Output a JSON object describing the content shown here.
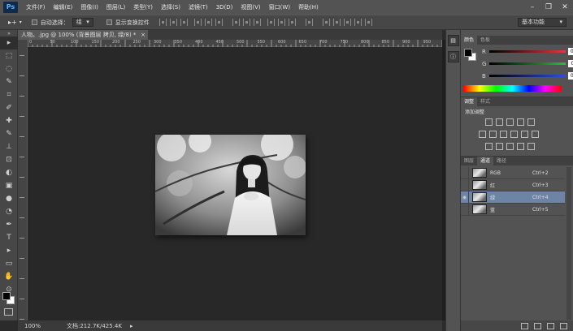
{
  "app": {
    "logo": "Ps"
  },
  "menu": [
    "文件(F)",
    "编辑(E)",
    "图像(I)",
    "图层(L)",
    "类型(Y)",
    "选择(S)",
    "滤镜(T)",
    "3D(D)",
    "视图(V)",
    "窗口(W)",
    "帮助(H)"
  ],
  "window_controls": {
    "minimize": "–",
    "restore": "❐",
    "close": "✕"
  },
  "options": {
    "tool_glyph": "▸+",
    "auto_select_label": "自动选择：",
    "auto_select_value": "组",
    "show_transform_label": "显示变换控件",
    "workspace": "基本功能"
  },
  "document": {
    "tab_title": "人物。.jpg @ 100% (背景图层 拷贝, 绿/8) *",
    "close_glyph": "×",
    "ruler_labels": [
      "0",
      "50",
      "100",
      "150",
      "200",
      "250",
      "300",
      "350",
      "400",
      "450",
      "500",
      "550",
      "600",
      "650",
      "700",
      "750",
      "800",
      "850",
      "900",
      "950",
      "1000"
    ]
  },
  "status": {
    "zoom": "100%",
    "doc_info": "文档:212.7K/425.4K"
  },
  "color_panel": {
    "tabs": [
      "颜色",
      "色板"
    ],
    "channels": [
      {
        "label": "R",
        "value": "0",
        "color": "#e23a3a"
      },
      {
        "label": "G",
        "value": "0",
        "color": "#2fb84a"
      },
      {
        "label": "B",
        "value": "0",
        "color": "#2d4fe0"
      }
    ]
  },
  "adjust_panel": {
    "tabs": [
      "调整",
      "样式"
    ],
    "title": "添加调整"
  },
  "channels_panel": {
    "tabs": [
      "图层",
      "通道",
      "路径"
    ],
    "rows": [
      {
        "name": "RGB",
        "shortcut": "Ctrl+2",
        "visible": false
      },
      {
        "name": "红",
        "shortcut": "Ctrl+3",
        "visible": false
      },
      {
        "name": "绿",
        "shortcut": "Ctrl+4",
        "visible": true
      },
      {
        "name": "蓝",
        "shortcut": "Ctrl+5",
        "visible": false
      }
    ],
    "eye_glyph": "◉"
  },
  "tools": [
    "▸",
    "⬚",
    "◌",
    "✎",
    "⌗",
    "✐",
    "✚",
    "✎",
    "⊥",
    "⊡",
    "◐",
    "▣",
    "●",
    "◔",
    "✒",
    "T",
    "▸",
    "▭",
    "✋",
    "⊙"
  ]
}
